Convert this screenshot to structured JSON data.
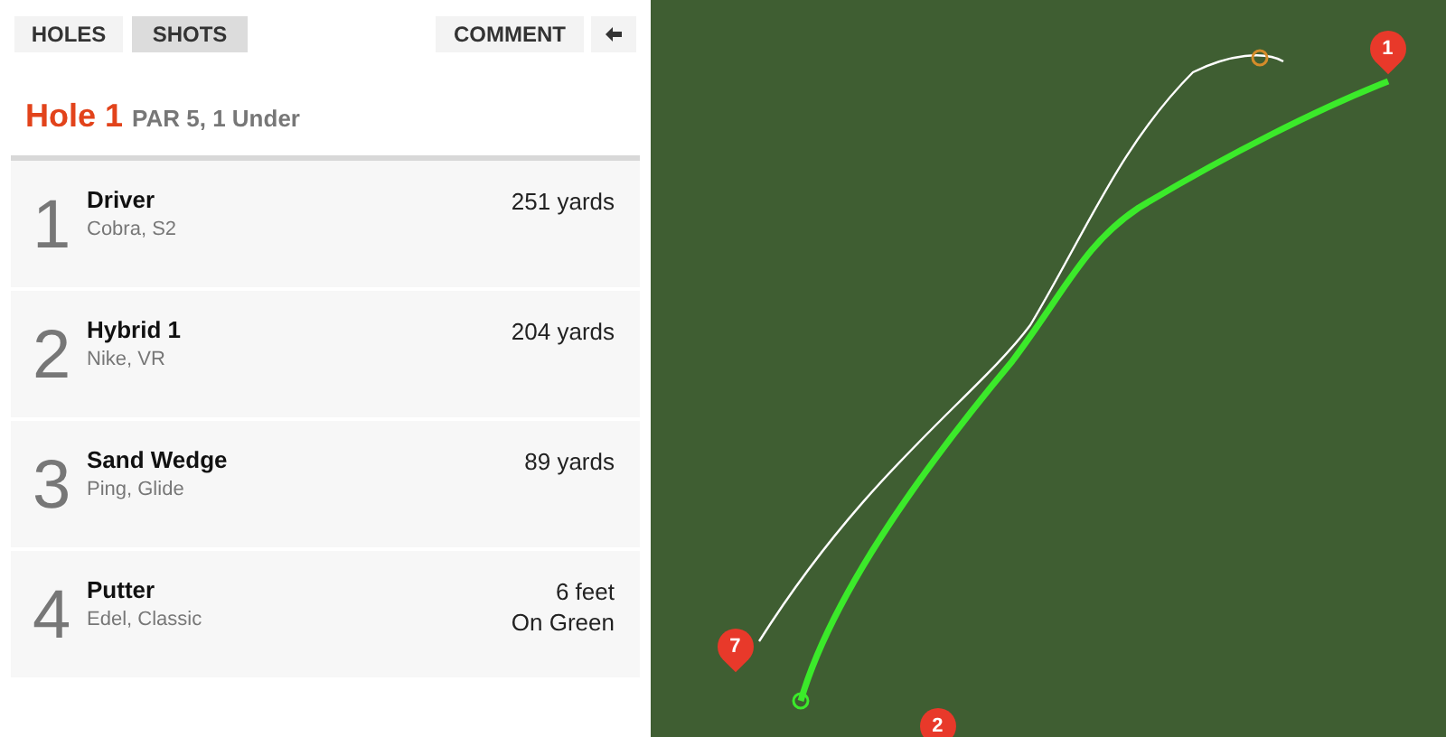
{
  "tabs": [
    {
      "label": "HOLES",
      "selected": false
    },
    {
      "label": "SHOTS",
      "selected": true
    }
  ],
  "comment_button": "COMMENT",
  "heading": {
    "hole": "Hole 1",
    "summary": "PAR 5, 1 Under"
  },
  "shots": [
    {
      "number": "1",
      "club": "Driver",
      "model": "Cobra, S2",
      "distance": [
        "251 yards"
      ]
    },
    {
      "number": "2",
      "club": "Hybrid 1",
      "model": "Nike, VR",
      "distance": [
        "204 yards"
      ]
    },
    {
      "number": "3",
      "club": "Sand Wedge",
      "model": "Ping, Glide",
      "distance": [
        "89 yards"
      ]
    },
    {
      "number": "4",
      "club": "Putter",
      "model": "Edel, Classic",
      "distance": [
        "6 feet",
        "On Green"
      ]
    }
  ],
  "map": {
    "pins": [
      {
        "label": "1"
      },
      {
        "label": "7"
      },
      {
        "label": "2"
      }
    ]
  }
}
